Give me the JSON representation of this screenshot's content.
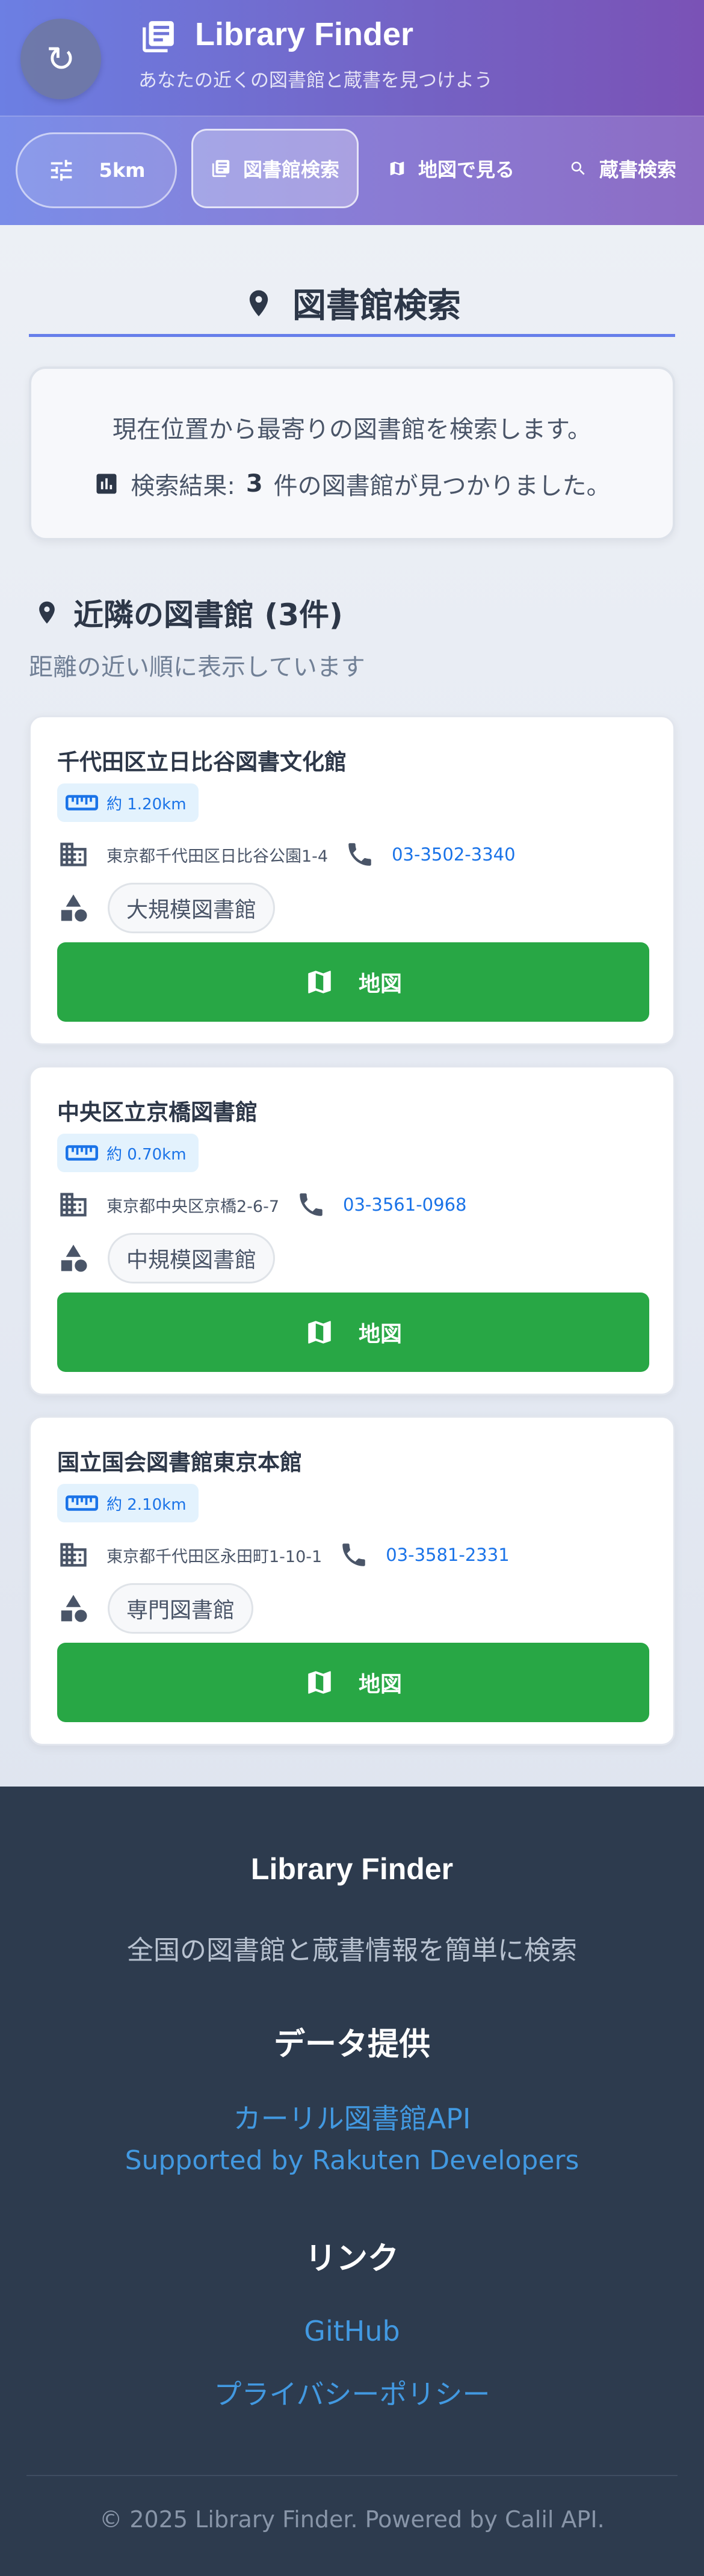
{
  "header": {
    "refresh_icon": "refresh-icon",
    "title": "Library Finder",
    "subtitle": "あなたの近くの図書館と蔵書を見つけよう"
  },
  "nav": {
    "range_label": "5km",
    "tabs": [
      {
        "label": "図書館検索",
        "icon": "library-icon",
        "active": true
      },
      {
        "label": "地図で見る",
        "icon": "map-icon",
        "active": false
      },
      {
        "label": "蔵書検索",
        "icon": "search-icon",
        "active": false
      }
    ]
  },
  "search": {
    "heading": "図書館検索",
    "info_text": "現在位置から最寄りの図書館を検索します。",
    "result_prefix": "検索結果:",
    "result_count": "3",
    "result_suffix": "件の図書館が見つかりました。"
  },
  "nearby": {
    "heading": "近隣の図書館 (3件)",
    "subheading": "距離の近い順に表示しています"
  },
  "libraries": [
    {
      "name": "千代田区立日比谷図書文化館",
      "distance": "約 1.20km",
      "address": "東京都千代田区日比谷公園1-4",
      "phone": "03-3502-3340",
      "category": "大規模図書館",
      "button": "地図"
    },
    {
      "name": "中央区立京橋図書館",
      "distance": "約 0.70km",
      "address": "東京都中央区京橋2-6-7",
      "phone": "03-3561-0968",
      "category": "中規模図書館",
      "button": "地図"
    },
    {
      "name": "国立国会図書館東京本館",
      "distance": "約 2.10km",
      "address": "東京都千代田区永田町1-10-1",
      "phone": "03-3581-2331",
      "category": "専門図書館",
      "button": "地図"
    }
  ],
  "footer": {
    "title": "Library Finder",
    "tagline": "全国の図書館と蔵書情報を簡単に検索",
    "data_heading": "データ提供",
    "data_link1": "カーリル図書館API",
    "data_link2": "Supported by Rakuten Developers",
    "links_heading": "リンク",
    "link_github": "GitHub",
    "link_privacy": "プライバシーポリシー",
    "copyright": "© 2025 Library Finder. Powered by Calil API."
  },
  "colors": {
    "accent": "#667eea",
    "map_button": "#28a745",
    "link": "#1a73e8",
    "footer_bg": "#2d3b4e"
  }
}
